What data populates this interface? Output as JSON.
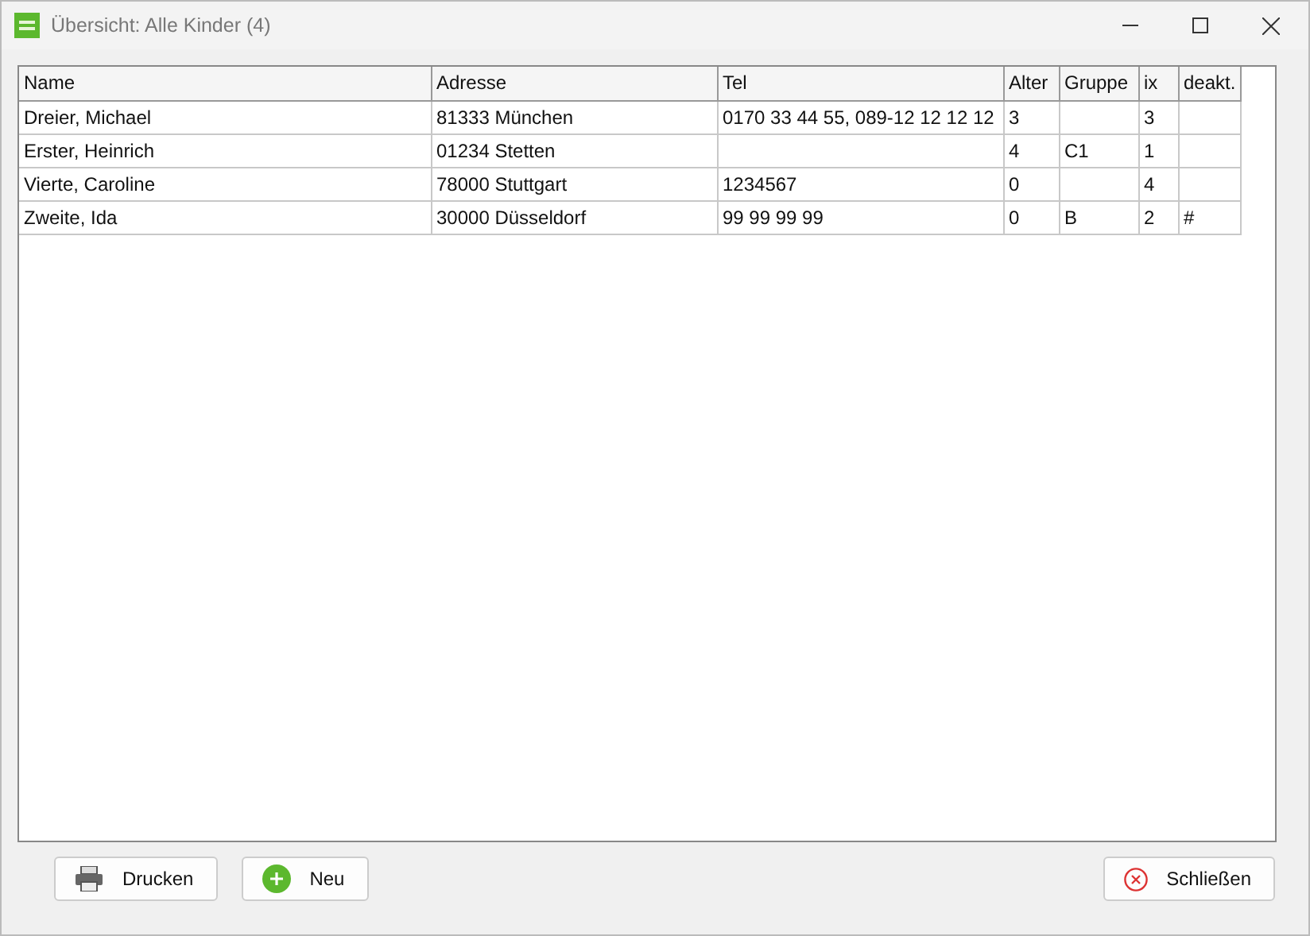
{
  "window": {
    "title": "Übersicht: Alle Kinder (4)"
  },
  "table": {
    "columns": [
      "Name",
      "Adresse",
      "Tel",
      "Alter",
      "Gruppe",
      "ix",
      "deakt."
    ],
    "rows": [
      [
        "Dreier, Michael",
        "81333 München",
        "0170 33 44 55, 089-12 12 12 12",
        "3",
        "",
        "3",
        ""
      ],
      [
        "Erster, Heinrich",
        "01234 Stetten",
        "",
        "4",
        "C1",
        "1",
        ""
      ],
      [
        "Vierte, Caroline",
        "78000 Stuttgart",
        "1234567",
        "0",
        "",
        "4",
        ""
      ],
      [
        "Zweite, Ida",
        "30000 Düsseldorf",
        "99 99 99 99",
        "0",
        "B",
        "2",
        "#"
      ]
    ]
  },
  "buttons": [
    {
      "kind": "print",
      "label": "Drucken"
    },
    {
      "kind": "add",
      "label": "Neu"
    },
    {
      "kind": "close",
      "label": "Schließen"
    }
  ]
}
